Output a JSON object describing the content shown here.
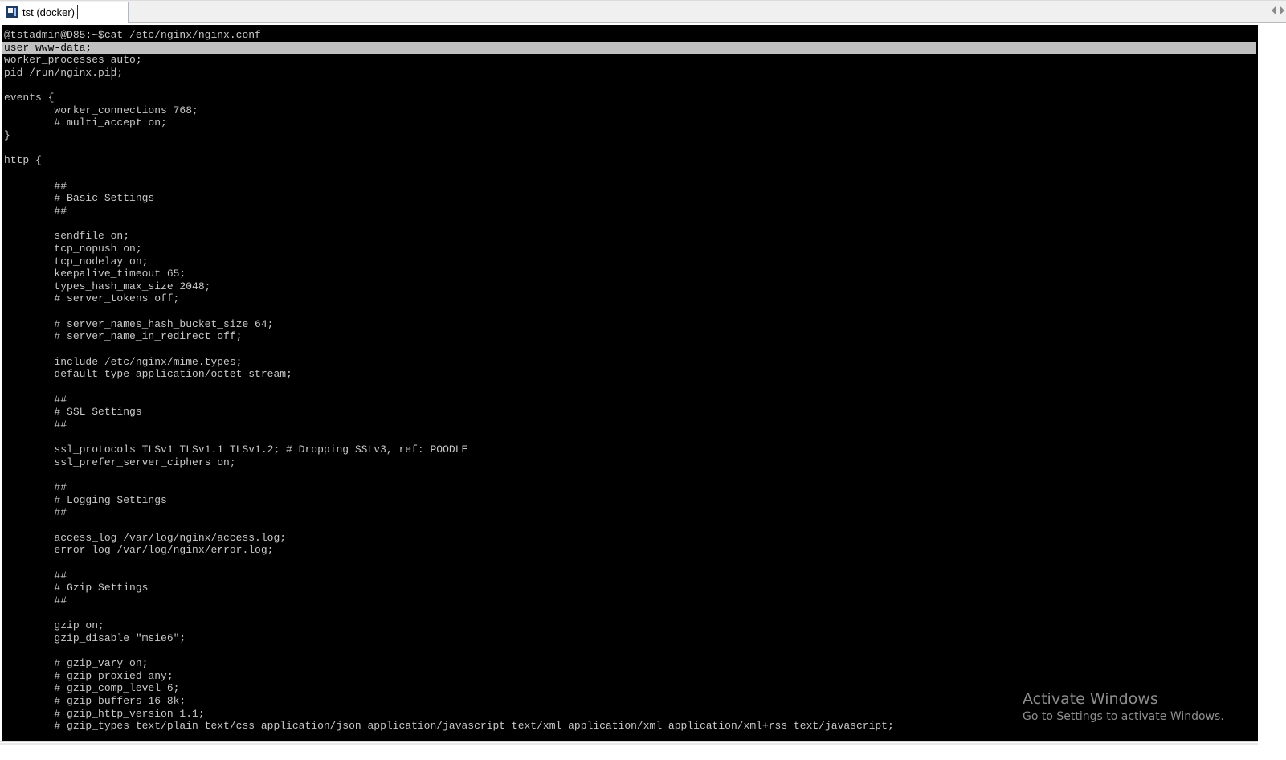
{
  "tab": {
    "title": "tst (docker)",
    "icon": "terminal-app-icon"
  },
  "terminal": {
    "lines": [
      "@tstadmin@D85:~$cat /etc/nginx/nginx.conf",
      "user www-data;",
      "worker_processes auto;",
      "pid /run/nginx.pid;",
      "",
      "events {",
      "        worker_connections 768;",
      "        # multi_accept on;",
      "}",
      "",
      "http {",
      "",
      "        ##",
      "        # Basic Settings",
      "        ##",
      "",
      "        sendfile on;",
      "        tcp_nopush on;",
      "        tcp_nodelay on;",
      "        keepalive_timeout 65;",
      "        types_hash_max_size 2048;",
      "        # server_tokens off;",
      "",
      "        # server_names_hash_bucket_size 64;",
      "        # server_name_in_redirect off;",
      "",
      "        include /etc/nginx/mime.types;",
      "        default_type application/octet-stream;",
      "",
      "        ##",
      "        # SSL Settings",
      "        ##",
      "",
      "        ssl_protocols TLSv1 TLSv1.1 TLSv1.2; # Dropping SSLv3, ref: POODLE",
      "        ssl_prefer_server_ciphers on;",
      "",
      "        ##",
      "        # Logging Settings",
      "        ##",
      "",
      "        access_log /var/log/nginx/access.log;",
      "        error_log /var/log/nginx/error.log;",
      "",
      "        ##",
      "        # Gzip Settings",
      "        ##",
      "",
      "        gzip on;",
      "        gzip_disable \"msie6\";",
      "",
      "        # gzip_vary on;",
      "        # gzip_proxied any;",
      "        # gzip_comp_level 6;",
      "        # gzip_buffers 16 8k;",
      "        # gzip_http_version 1.1;",
      "        # gzip_types text/plain text/css application/json application/javascript text/xml application/xml application/xml+rss text/javascript;"
    ],
    "selected_line_index": 1,
    "text_color": "#c8c8c8",
    "background_color": "#000000",
    "selection_color": "#c0c0c0"
  },
  "watermark": {
    "title": "Activate Windows",
    "subtitle": "Go to Settings to activate Windows."
  }
}
